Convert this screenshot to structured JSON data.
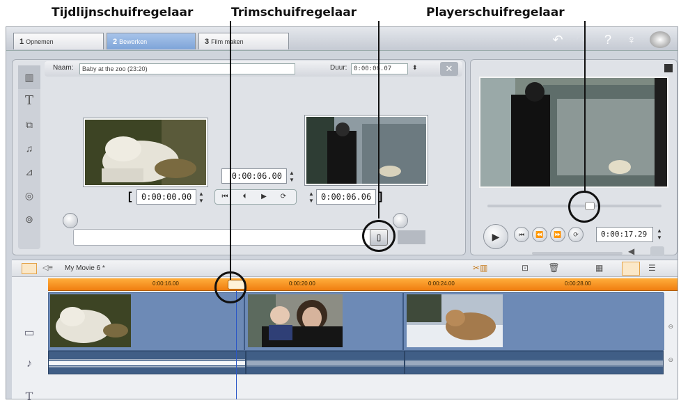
{
  "callouts": {
    "timeline_slider": "Tijdlijnschuifregelaar",
    "trim_slider": "Trimschuifregelaar",
    "player_slider": "Playerschuifregelaar"
  },
  "tabs": [
    {
      "num": "1",
      "label": "Opnemen"
    },
    {
      "num": "2",
      "label": "Bewerken"
    },
    {
      "num": "3",
      "label": "Film maken"
    }
  ],
  "editor": {
    "name_label": "Naam:",
    "name_value": "Baby at the zoo (23:20)",
    "duration_label": "Duur:",
    "duration_value": "0:00:06.07",
    "close_glyph": "✕",
    "in_timecode": "0:00:00.00",
    "mid_timecode": "0:00:06.00",
    "out_timecode": "0:00:06.06",
    "in_bracket": "[",
    "out_bracket": "]",
    "sidebar_icons": [
      "film-icon",
      "title-icon",
      "overlay-icon",
      "sound-icon",
      "transition-icon",
      "disc-icon",
      "effect-icon"
    ]
  },
  "player": {
    "timecode": "0:00:17.29"
  },
  "timeline": {
    "project_title": "My Movie 6 *",
    "ruler_marks": [
      "0:00:16.00",
      "0:00:20.00",
      "0:00:24.00",
      "0:00:28.00"
    ]
  },
  "colors": {
    "ruler": "#f28a1a",
    "active_tab": "#86a9dc",
    "track_video": "#6d8ab6",
    "track_audio": "#405e86"
  }
}
